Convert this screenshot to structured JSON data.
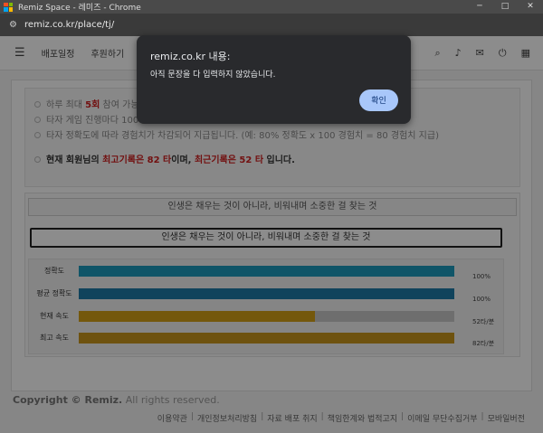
{
  "window": {
    "title": "Remiz Space - 레미즈 - Chrome",
    "controls": [
      "─",
      "□",
      "✕"
    ]
  },
  "address_bar": {
    "url": "remiz.co.kr/place/tj/",
    "icon": "site-settings-icon"
  },
  "navbar": {
    "items": [
      "배포일정",
      "후원하기"
    ],
    "icons": [
      "search-icon",
      "bell-icon",
      "mail-icon",
      "power-icon",
      "grid-icon"
    ]
  },
  "notice": {
    "line1_a": "하루 최대 ",
    "line1_b": "5회",
    "line1_c": " 참여 가능",
    "line2": "타자 게임 진행마다 100",
    "line3": "타자 정확도에 따라 경험치가 차감되어 지급됩니다. (예: 80% 정확도 x 100 경험치 = 80 경험치 지급)",
    "record_a": "현재 회원님의 ",
    "record_best": "최고기록은 82 타",
    "record_b": "이며, ",
    "record_recent": "최근기록은 52 타",
    "record_c": " 입니다."
  },
  "typing": {
    "sentence": "인생은 채우는 것이 아니라, 비워내며 소중한 걸 찾는 것",
    "input_value": "인생은 채우는 것이 아니라, 비워내며 소중한 걸 찾는 것"
  },
  "stats": [
    {
      "label": "정확도",
      "value": "100%",
      "fill": 1.0,
      "color": "#1e9cbe"
    },
    {
      "label": "평균 정확도",
      "value": "100%",
      "fill": 1.0,
      "color": "#1e7ba8"
    },
    {
      "label": "현재 속도",
      "value": "52타/분",
      "fill": 0.63,
      "color": "#d4a017"
    },
    {
      "label": "최고 속도",
      "value": "82타/분",
      "fill": 1.0,
      "color": "#c8961c"
    }
  ],
  "footer": {
    "copyright": "Copyright © Remiz.",
    "rights": " All rights reserved.",
    "links": [
      "이용약관",
      "개인정보처리방침",
      "자료 배포 취지",
      "책임한계와 법적고지",
      "이메일 무단수집거부",
      "모바일버전"
    ]
  },
  "dialog": {
    "title": "remiz.co.kr 내용:",
    "message": "아직 문장을 다 입력하지 않았습니다.",
    "ok_label": "확인"
  },
  "colors": {
    "dialog_bg": "#292a2d",
    "ok_button": "#a8c7fa",
    "highlight_red": "#d02020"
  }
}
